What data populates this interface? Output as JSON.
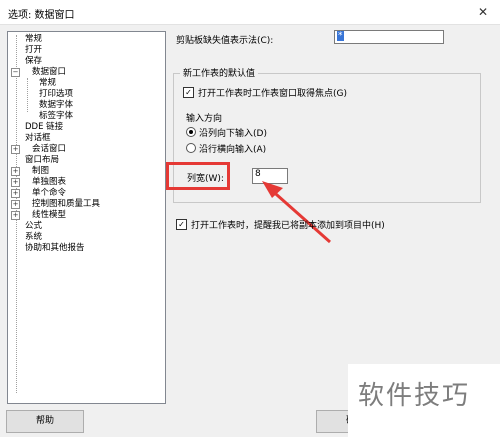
{
  "window": {
    "title": "选项: 数据窗口",
    "close_glyph": "✕"
  },
  "tree": {
    "items": [
      {
        "label": "常规",
        "level": 1
      },
      {
        "label": "打开",
        "level": 1
      },
      {
        "label": "保存",
        "level": 1
      },
      {
        "label": "数据窗口",
        "level": 0,
        "expander": "-"
      },
      {
        "label": "常规",
        "level": 2
      },
      {
        "label": "打印选项",
        "level": 2
      },
      {
        "label": "数据字体",
        "level": 2
      },
      {
        "label": "标签字体",
        "level": 2
      },
      {
        "label": "DDE 链接",
        "level": 1
      },
      {
        "label": "对话框",
        "level": 1
      },
      {
        "label": "会话窗口",
        "level": 0,
        "expander": "+"
      },
      {
        "label": "窗口布局",
        "level": 1
      },
      {
        "label": "制图",
        "level": 0,
        "expander": "+"
      },
      {
        "label": "单独图表",
        "level": 0,
        "expander": "+"
      },
      {
        "label": "单个命令",
        "level": 0,
        "expander": "+"
      },
      {
        "label": "控制图和质量工具",
        "level": 0,
        "expander": "+"
      },
      {
        "label": "线性模型",
        "level": 0,
        "expander": "+"
      },
      {
        "label": "公式",
        "level": 1
      },
      {
        "label": "系统",
        "level": 1
      },
      {
        "label": "协助和其他报告",
        "level": 1
      }
    ]
  },
  "clipboard": {
    "label": "剪贴板缺失值表示法(C):",
    "value": "*"
  },
  "new_worksheet": {
    "group_title": "新工作表的默认值",
    "focus_checkbox": {
      "label": "打开工作表时工作表窗口取得焦点(G)",
      "checked": true
    },
    "direction_label": "输入方向",
    "radios": [
      {
        "label": "沿列向下输入(D)",
        "selected": true
      },
      {
        "label": "沿行横向输入(A)",
        "selected": false
      }
    ],
    "column_width": {
      "label": "列宽(W):",
      "value": "8"
    }
  },
  "remind_checkbox": {
    "label": "打开工作表时，提醒我已将副本添加到项目中(H)",
    "checked": true
  },
  "buttons": {
    "help": "帮助",
    "ok": "确定"
  },
  "watermark": "软件技巧",
  "colors": {
    "highlight": "#e53935",
    "arrow": "#e53935"
  }
}
